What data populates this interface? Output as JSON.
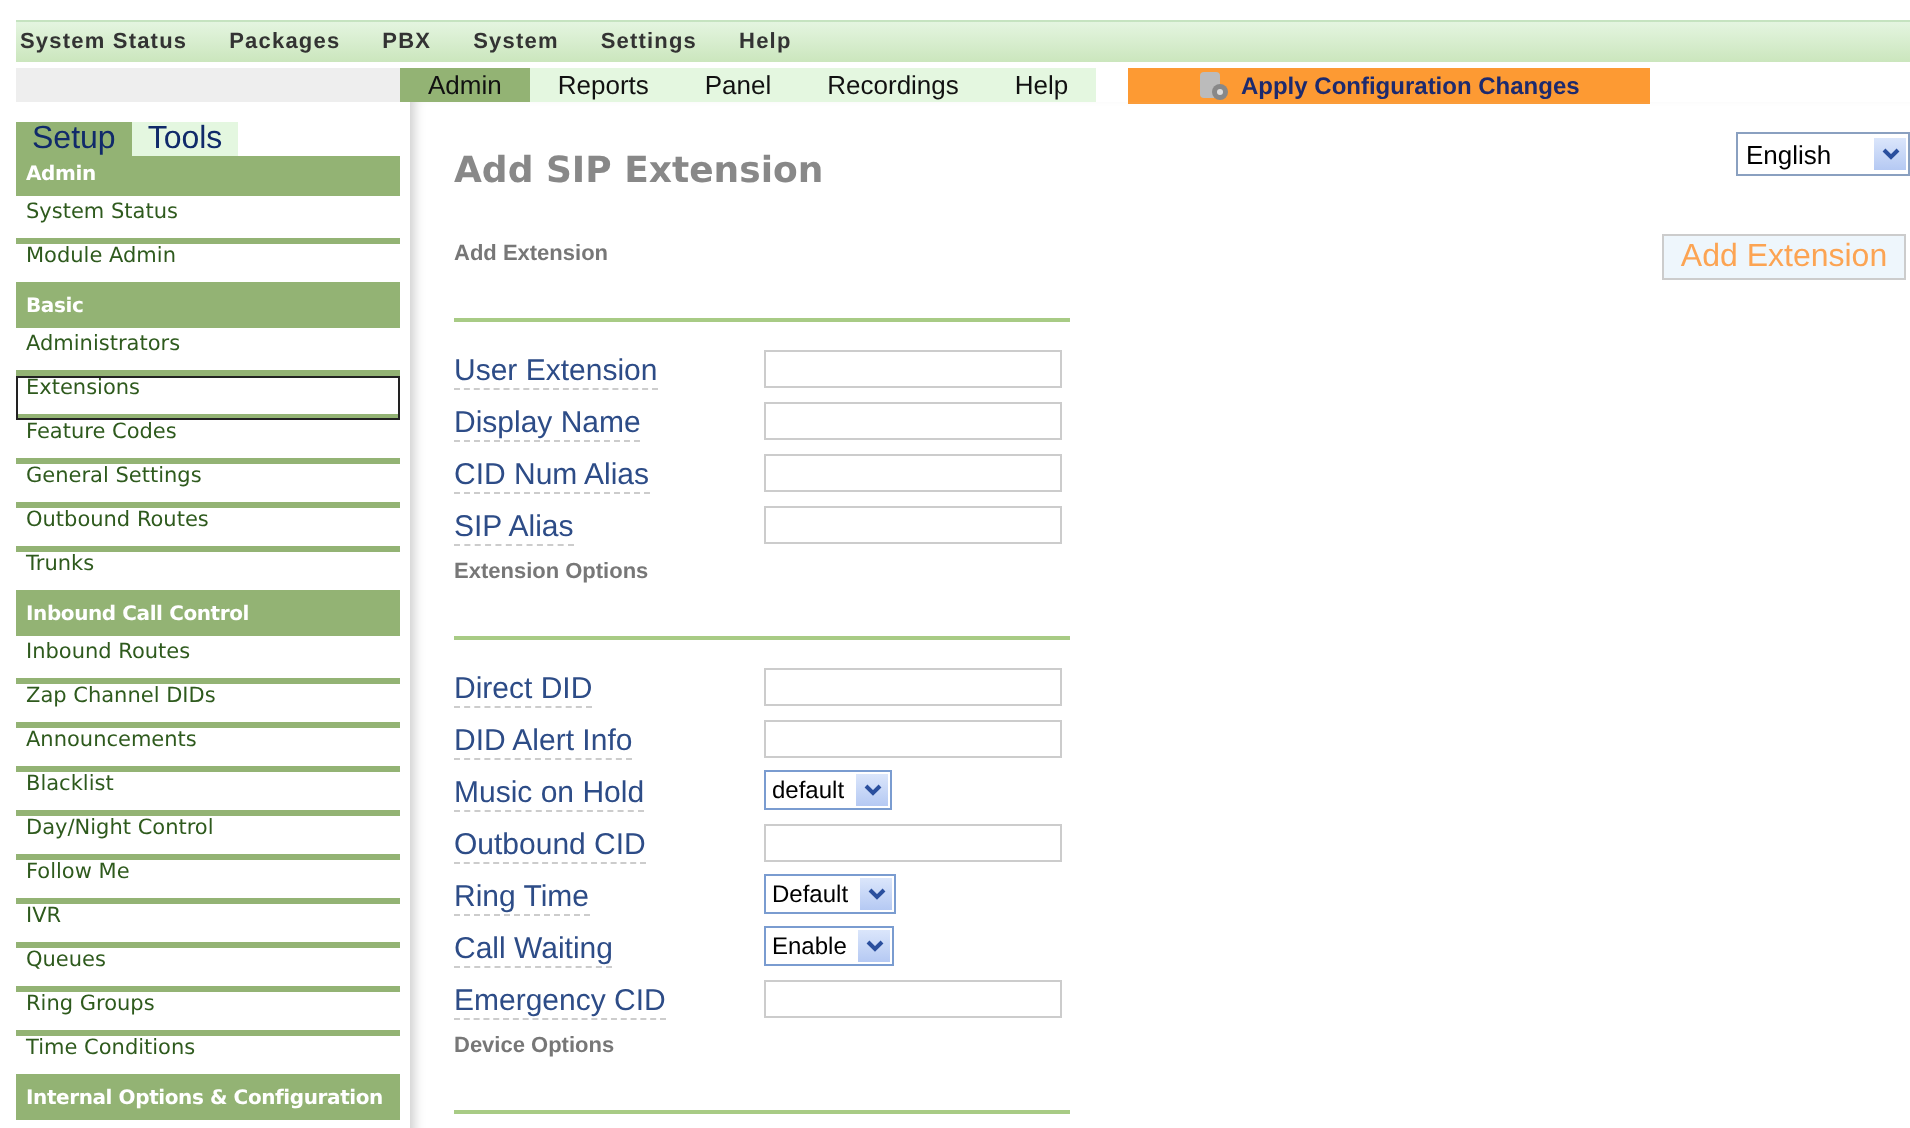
{
  "top_menu": [
    "System Status",
    "Packages",
    "PBX",
    "System",
    "Settings",
    "Help"
  ],
  "sub_tabs": [
    {
      "label": "Admin",
      "selected": true
    },
    {
      "label": "Reports",
      "selected": false
    },
    {
      "label": "Panel",
      "selected": false
    },
    {
      "label": "Recordings",
      "selected": false
    },
    {
      "label": "Help",
      "selected": false
    }
  ],
  "apply_button": "Apply Configuration Changes",
  "sidebar": {
    "tabs": [
      {
        "label": "Setup",
        "selected": true
      },
      {
        "label": "Tools",
        "selected": false
      }
    ],
    "items": [
      {
        "kind": "header",
        "label": "Admin"
      },
      {
        "kind": "item",
        "label": "System Status",
        "selected": false
      },
      {
        "kind": "item",
        "label": "Module Admin",
        "selected": false
      },
      {
        "kind": "header",
        "label": "Basic"
      },
      {
        "kind": "item",
        "label": "Administrators",
        "selected": false
      },
      {
        "kind": "item",
        "label": "Extensions",
        "selected": true
      },
      {
        "kind": "item",
        "label": "Feature Codes",
        "selected": false
      },
      {
        "kind": "item",
        "label": "General Settings",
        "selected": false
      },
      {
        "kind": "item",
        "label": "Outbound Routes",
        "selected": false
      },
      {
        "kind": "item",
        "label": "Trunks",
        "selected": false
      },
      {
        "kind": "header",
        "label": "Inbound Call Control"
      },
      {
        "kind": "item",
        "label": "Inbound Routes",
        "selected": false
      },
      {
        "kind": "item",
        "label": "Zap Channel DIDs",
        "selected": false
      },
      {
        "kind": "item",
        "label": "Announcements",
        "selected": false
      },
      {
        "kind": "item",
        "label": "Blacklist",
        "selected": false
      },
      {
        "kind": "item",
        "label": "Day/Night Control",
        "selected": false
      },
      {
        "kind": "item",
        "label": "Follow Me",
        "selected": false
      },
      {
        "kind": "item",
        "label": "IVR",
        "selected": false
      },
      {
        "kind": "item",
        "label": "Queues",
        "selected": false
      },
      {
        "kind": "item",
        "label": "Ring Groups",
        "selected": false
      },
      {
        "kind": "item",
        "label": "Time Conditions",
        "selected": false
      },
      {
        "kind": "header",
        "label": "Internal Options & Configuration"
      }
    ]
  },
  "language": "English",
  "page_title": "Add SIP Extension",
  "add_extension_button": "Add Extension",
  "sections": [
    {
      "heading": "Add Extension",
      "fields": [
        {
          "kind": "text",
          "label": "User Extension"
        },
        {
          "kind": "text",
          "label": "Display Name"
        },
        {
          "kind": "text",
          "label": "CID Num Alias"
        },
        {
          "kind": "text",
          "label": "SIP Alias"
        }
      ]
    },
    {
      "heading": "Extension Options",
      "fields": [
        {
          "kind": "text",
          "label": "Direct DID"
        },
        {
          "kind": "text",
          "label": "DID Alert Info"
        },
        {
          "kind": "select",
          "label": "Music on Hold",
          "value": "default"
        },
        {
          "kind": "text",
          "label": "Outbound CID"
        },
        {
          "kind": "select",
          "label": "Ring Time",
          "value": "Default"
        },
        {
          "kind": "select",
          "label": "Call Waiting",
          "value": "Enable"
        },
        {
          "kind": "text",
          "label": "Emergency CID"
        }
      ]
    },
    {
      "heading": "Device Options"
    }
  ]
}
